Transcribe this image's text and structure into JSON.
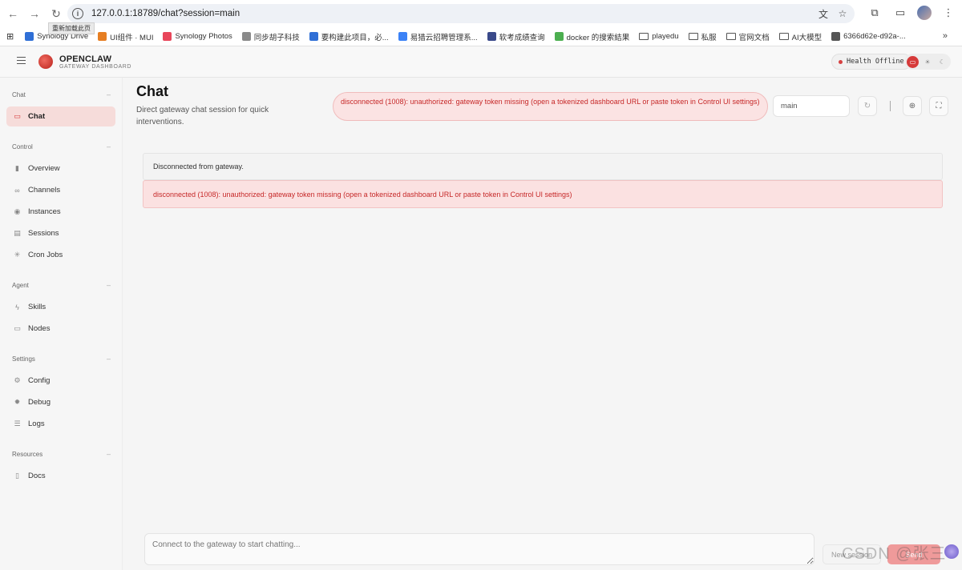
{
  "browser": {
    "url": "127.0.0.1:18789/chat?session=main",
    "tooltip": "重新加载此页",
    "bookmarks": [
      {
        "label": "Synology Drive",
        "color": "#2f6fd6"
      },
      {
        "label": "UI组件 · MUI",
        "color": "#e67e22"
      },
      {
        "label": "Synology Photos",
        "color": "#e8465a"
      },
      {
        "label": "同步胡子科技",
        "color": "#8a8a8a"
      },
      {
        "label": "要构建此项目，必...",
        "color": "#2f6fd6"
      },
      {
        "label": "易猎云招聘管理系...",
        "color": "#3b82f6"
      },
      {
        "label": "软考成绩查询",
        "color": "#3a4a8a"
      },
      {
        "label": "docker 的搜索結果",
        "color": "#4caf50"
      },
      {
        "label": "playedu",
        "folder": true
      },
      {
        "label": "私服",
        "folder": true
      },
      {
        "label": "官网文档",
        "folder": true
      },
      {
        "label": "AI大模型",
        "folder": true
      },
      {
        "label": "6366d62e-d92a-...",
        "color": "#555555"
      }
    ]
  },
  "app": {
    "brand": "OPENCLAW",
    "brand_sub": "GATEWAY DASHBOARD",
    "health": "Health Offline",
    "accent": "#d63a3a"
  },
  "sidebar": {
    "sections": [
      {
        "title": "Chat",
        "items": [
          {
            "label": "Chat",
            "icon": "chat-bubble-icon",
            "active": true
          }
        ]
      },
      {
        "title": "Control",
        "items": [
          {
            "label": "Overview",
            "icon": "bar-chart-icon"
          },
          {
            "label": "Channels",
            "icon": "link-icon"
          },
          {
            "label": "Instances",
            "icon": "radio-waves-icon"
          },
          {
            "label": "Sessions",
            "icon": "document-icon"
          },
          {
            "label": "Cron Jobs",
            "icon": "loader-icon"
          }
        ]
      },
      {
        "title": "Agent",
        "items": [
          {
            "label": "Skills",
            "icon": "lightning-icon"
          },
          {
            "label": "Nodes",
            "icon": "monitor-icon"
          }
        ]
      },
      {
        "title": "Settings",
        "items": [
          {
            "label": "Config",
            "icon": "gear-icon"
          },
          {
            "label": "Debug",
            "icon": "bug-icon"
          },
          {
            "label": "Logs",
            "icon": "scroll-icon"
          }
        ]
      },
      {
        "title": "Resources",
        "items": [
          {
            "label": "Docs",
            "icon": "book-icon"
          }
        ]
      }
    ]
  },
  "main": {
    "title": "Chat",
    "subtitle": "Direct gateway chat session for quick interventions.",
    "error_pill": "disconnected (1008): unauthorized: gateway token missing (open a tokenized dashboard URL or paste token in Control UI settings)",
    "session_value": "main",
    "messages": {
      "info": "Disconnected from gateway.",
      "error": "disconnected (1008): unauthorized: gateway token missing (open a tokenized dashboard URL or paste token in Control UI settings)"
    },
    "composer_placeholder": "Connect to the gateway to start chatting...",
    "new_session_label": "New session",
    "send_label": "Send",
    "watermark": "CSDN @张三"
  }
}
